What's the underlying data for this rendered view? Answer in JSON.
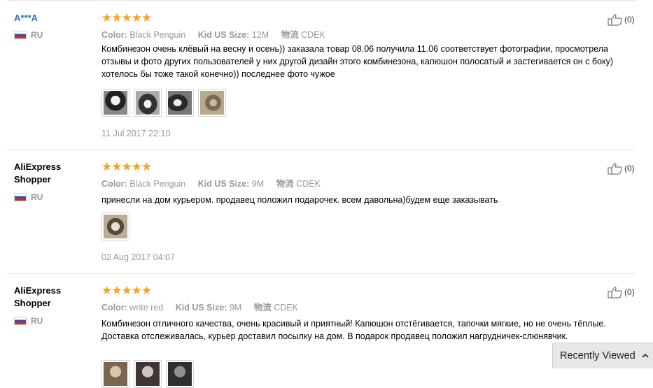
{
  "reviews": [
    {
      "user": "A***A",
      "country": "RU",
      "stars": "★★★★★",
      "color_label": "Color:",
      "color_value": "Black Penguin",
      "size_label": "Kid US Size:",
      "size_value": "12M",
      "shipping_label": "物流",
      "shipping_value": "CDEK",
      "text": "Комбинезон очень клёвый на весну и осень)) заказала товар 08.06 получила 11.06 соответствует фотографии, просмотрела отзывы и фото других пользователей у них другой дизайн этого комбинезона, капюшон полосатый и застегивается он с боку) хотелось бы тоже такой конечно)) последнее фото чужое",
      "date": "11 Jul 2017 22:10",
      "likes": "(0)"
    },
    {
      "user": "AliExpress Shopper",
      "country": "RU",
      "stars": "★★★★★",
      "color_label": "Color:",
      "color_value": "Black Penguin",
      "size_label": "Kid US Size:",
      "size_value": "9M",
      "shipping_label": "物流",
      "shipping_value": "CDEK",
      "text": "принесли на дом курьером. продавец положил подарочек. всем давольна)будем еще заказывать",
      "date": "02 Aug 2017 04:07",
      "likes": "(0)"
    },
    {
      "user": "AliExpress Shopper",
      "country": "RU",
      "stars": "★★★★★",
      "color_label": "Color:",
      "color_value": "write red",
      "size_label": "Kid US Size:",
      "size_value": "9M",
      "shipping_label": "物流",
      "shipping_value": "CDEK",
      "text": "Комбинезон отличного качества, очень красивый и приятный! Капюшон отстёгивается, тапочки мягкие, но не очень тёплые. Доставка отслеживалась, курьер доставил посылку на дом. В подарок продавец положил нагрудничек-слюнявчик.",
      "likes": "(0)"
    }
  ],
  "recently_viewed": "Recently Viewed",
  "colors": {
    "stars": "#f7a21b",
    "link": "#2b6fd1",
    "muted": "#999999"
  }
}
